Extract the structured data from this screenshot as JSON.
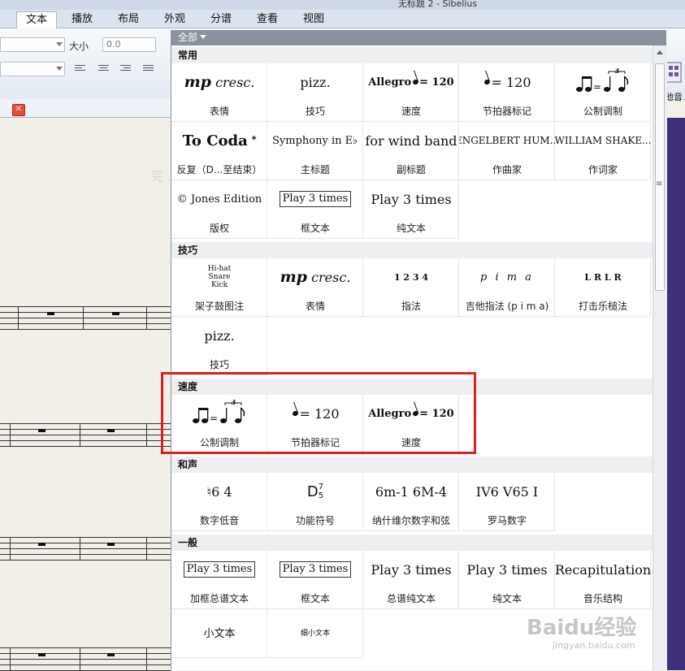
{
  "window": {
    "title": "无标题 2 - Sibelius"
  },
  "tabs": [
    "文本",
    "播放",
    "布局",
    "外观",
    "分谱",
    "查看",
    "视图"
  ],
  "ribbon": {
    "size_label": "大小",
    "size_value": "0.0",
    "right_label": "他音"
  },
  "dropdown": {
    "filter_label": "全部",
    "sections": {
      "common": "常用",
      "technique": "技巧",
      "tempo": "速度",
      "harmony": "和声",
      "general": "一般"
    },
    "common_items": [
      {
        "preview": "cresc.",
        "preview_bold": "mp",
        "caption": "表情"
      },
      {
        "preview": "pizz.",
        "caption": "技巧"
      },
      {
        "preview": "Allegro",
        "tempo": "= 120",
        "caption": "速度"
      },
      {
        "tempo": "= 120",
        "caption": "节拍器标记"
      },
      {
        "caption": "公制调制"
      },
      {
        "preview": "To Coda",
        "symbol": "𝄌",
        "caption": "反复（D...至结束）"
      },
      {
        "preview": "Symphony in E♭",
        "caption": "主标题"
      },
      {
        "preview": "for wind band",
        "caption": "副标题"
      },
      {
        "preview": "ENGELBERT HUM...",
        "caption": "作曲家"
      },
      {
        "preview": "WILLIAM SHAKE...",
        "caption": "作词家"
      },
      {
        "preview": "© Jones Edition",
        "caption": "版权"
      },
      {
        "preview": "Play 3 times",
        "caption": "框文本"
      },
      {
        "preview": "Play 3 times",
        "caption": "纯文本"
      }
    ],
    "technique_items": [
      {
        "drum_lines": [
          "Hi-hat",
          "Snare",
          "Kick"
        ],
        "caption": "架子鼓图注"
      },
      {
        "preview": "cresc.",
        "preview_bold": "mp",
        "caption": "表情"
      },
      {
        "preview": "1 2 3 4",
        "caption": "指法"
      },
      {
        "preview": "p i m a",
        "caption": "吉他指法 (p i m a)"
      },
      {
        "preview": "L R L R",
        "caption": "打击乐槌法"
      },
      {
        "preview": "pizz.",
        "caption": "技巧"
      }
    ],
    "tempo_items": [
      {
        "caption": "公制调制"
      },
      {
        "tempo": "= 120",
        "caption": "节拍器标记"
      },
      {
        "preview": "Allegro",
        "tempo": "= 120",
        "caption": "速度"
      }
    ],
    "harmony_items": [
      {
        "preview": "♮6 4",
        "caption": "数字低音"
      },
      {
        "preview": "D",
        "sup": "7",
        "sub": "5",
        "caption": "功能符号"
      },
      {
        "preview": "6m-1 6M-4",
        "caption": "纳什维尔数字和弦"
      },
      {
        "preview": "IV6 V65 I",
        "caption": "罗马数字"
      }
    ],
    "general_items": [
      {
        "preview": "Play 3 times",
        "caption": "加框总谱文本"
      },
      {
        "preview": "Play 3 times",
        "caption": "框文本"
      },
      {
        "preview": "Play 3 times",
        "caption": "总谱纯文本"
      },
      {
        "preview": "Play 3 times",
        "caption": "纯文本"
      },
      {
        "preview": "Recapitulation",
        "caption": "音乐结构"
      },
      {
        "preview": "小文本"
      },
      {
        "preview": "细小文本"
      }
    ]
  },
  "document": {
    "ghost_text": "完"
  },
  "watermark": {
    "brand": "Baidu经验",
    "url": "jingyan.baidu.com"
  }
}
